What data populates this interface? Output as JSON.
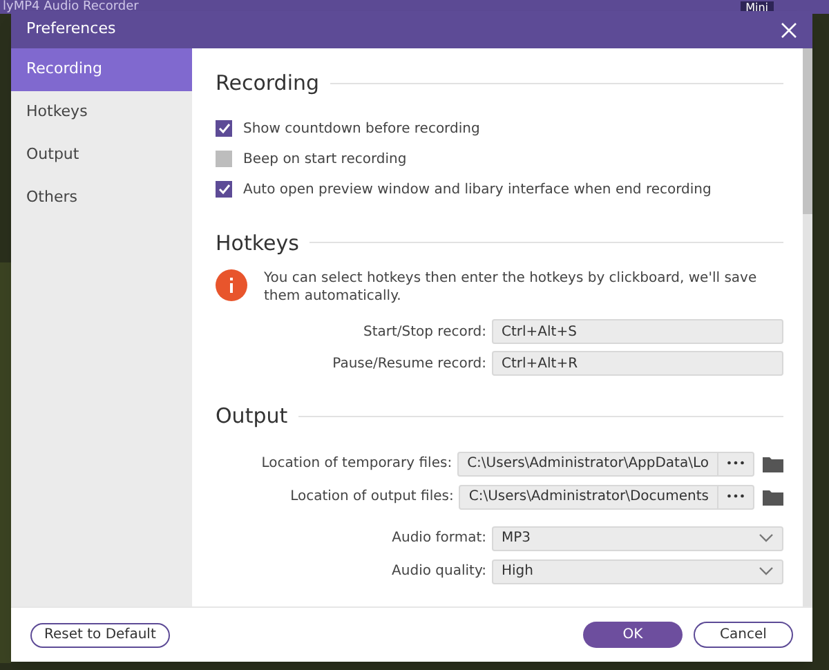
{
  "background_app": {
    "title": "lyMP4 Audio Recorder",
    "mini_label": "Mini"
  },
  "window": {
    "title": "Preferences"
  },
  "sidebar": {
    "items": [
      {
        "label": "Recording",
        "selected": true
      },
      {
        "label": "Hotkeys",
        "selected": false
      },
      {
        "label": "Output",
        "selected": false
      },
      {
        "label": "Others",
        "selected": false
      }
    ]
  },
  "recording": {
    "heading": "Recording",
    "options": [
      {
        "label": "Show countdown before recording",
        "checked": true
      },
      {
        "label": "Beep on start recording",
        "checked": false
      },
      {
        "label": "Auto open preview window and libary interface when end recording",
        "checked": true
      }
    ]
  },
  "hotkeys": {
    "heading": "Hotkeys",
    "info": "You can select hotkeys then enter the hotkeys by clickboard, we'll save them automatically.",
    "rows": [
      {
        "label": "Start/Stop record:",
        "value": "Ctrl+Alt+S"
      },
      {
        "label": "Pause/Resume record:",
        "value": "Ctrl+Alt+R"
      }
    ]
  },
  "output": {
    "heading": "Output",
    "rows": [
      {
        "kind": "path",
        "label": "Location of temporary files:",
        "value": "C:\\Users\\Administrator\\AppData\\Lo",
        "button": "•••"
      },
      {
        "kind": "path",
        "label": "Location of output files:",
        "value": "C:\\Users\\Administrator\\Documents",
        "button": "•••"
      },
      {
        "kind": "select",
        "label": "Audio format:",
        "value": "MP3"
      },
      {
        "kind": "select",
        "label": "Audio quality:",
        "value": "High"
      }
    ]
  },
  "footer": {
    "reset": "Reset to Default",
    "ok": "OK",
    "cancel": "Cancel"
  }
}
